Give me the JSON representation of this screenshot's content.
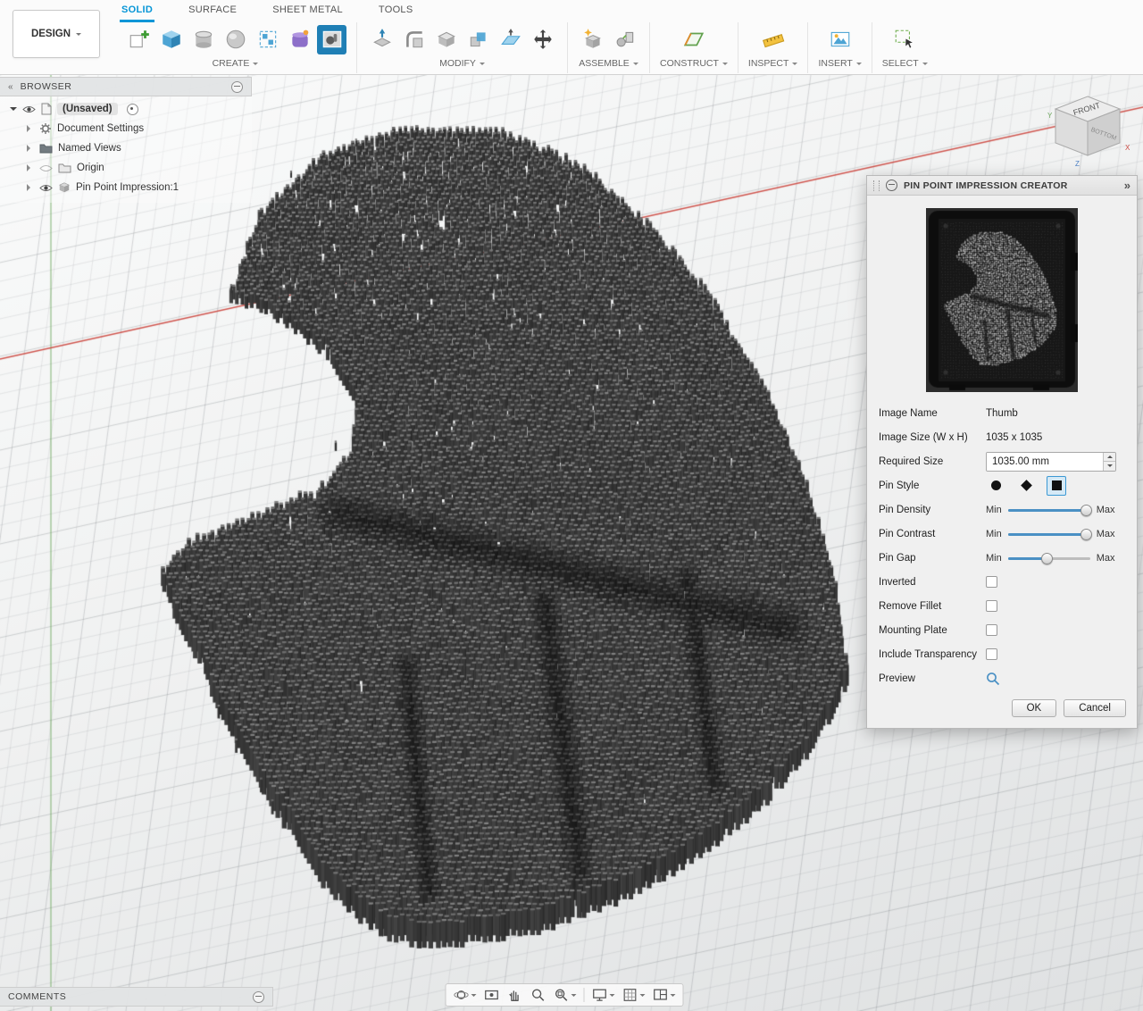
{
  "toolbar": {
    "design_label": "DESIGN",
    "tabs": [
      {
        "label": "SOLID",
        "active": true
      },
      {
        "label": "SURFACE",
        "active": false
      },
      {
        "label": "SHEET METAL",
        "active": false
      },
      {
        "label": "TOOLS",
        "active": false
      }
    ],
    "groups": [
      {
        "label": "CREATE",
        "icons": [
          "create-sketch",
          "box",
          "cylinder",
          "sphere",
          "rectangular-pattern",
          "create-form",
          "pin-point-image"
        ]
      },
      {
        "label": "MODIFY",
        "icons": [
          "press-pull",
          "fillet",
          "shell",
          "combine",
          "offset-face",
          "move"
        ]
      },
      {
        "label": "ASSEMBLE",
        "icons": [
          "new-component",
          "joint"
        ]
      },
      {
        "label": "CONSTRUCT",
        "icons": [
          "construction-plane"
        ]
      },
      {
        "label": "INSPECT",
        "icons": [
          "measure"
        ]
      },
      {
        "label": "INSERT",
        "icons": [
          "insert-image"
        ]
      },
      {
        "label": "SELECT",
        "icons": [
          "select"
        ]
      }
    ],
    "selected_icon": "pin-point-image"
  },
  "browser": {
    "title": "BROWSER",
    "collapse_icon": "«",
    "items": [
      {
        "label": "(Unsaved)"
      },
      {
        "label": "Document Settings"
      },
      {
        "label": "Named Views"
      },
      {
        "label": "Origin"
      },
      {
        "label": "Pin Point Impression:1"
      }
    ]
  },
  "viewcube": {
    "front": "FRONT",
    "bottom": "BOTTOM",
    "axes": [
      "X",
      "Y",
      "Z"
    ]
  },
  "dialog": {
    "title": "PIN POINT IMPRESSION CREATOR",
    "expand_icon": "»",
    "rows": {
      "image_name": {
        "label": "Image Name",
        "value": "Thumb"
      },
      "image_size": {
        "label": "Image Size (W x H)",
        "value": "1035 x 1035"
      },
      "required_size": {
        "label": "Required Size",
        "value": "1035.00 mm"
      },
      "pin_style": {
        "label": "Pin Style",
        "options": [
          "circle",
          "diamond",
          "square"
        ],
        "selected": "square"
      },
      "pin_density": {
        "label": "Pin Density",
        "min": "Min",
        "max": "Max",
        "value": 0.95
      },
      "pin_contrast": {
        "label": "Pin Contrast",
        "min": "Min",
        "max": "Max",
        "value": 0.95
      },
      "pin_gap": {
        "label": "Pin Gap",
        "min": "Min",
        "max": "Max",
        "value": 0.47
      },
      "inverted": {
        "label": "Inverted",
        "checked": false
      },
      "remove_fillet": {
        "label": "Remove Fillet",
        "checked": false
      },
      "mounting_plate": {
        "label": "Mounting Plate",
        "checked": false
      },
      "include_transparency": {
        "label": "Include Transparency",
        "checked": false
      },
      "preview": {
        "label": "Preview"
      }
    },
    "buttons": {
      "ok": "OK",
      "cancel": "Cancel"
    }
  },
  "comments": {
    "title": "COMMENTS"
  },
  "navbar": {
    "items": [
      "orbit",
      "look-at",
      "pan",
      "zoom",
      "fit",
      "display-settings",
      "grid-settings",
      "viewports"
    ]
  },
  "scene": {
    "model": "Pin Point Impression thumbs-up pin sculpture"
  },
  "colors": {
    "accent": "#0696d7",
    "axis_x": "#cc4a42",
    "axis_y": "#6fa85f",
    "selected_icon_bg": "#1f7fb5"
  }
}
